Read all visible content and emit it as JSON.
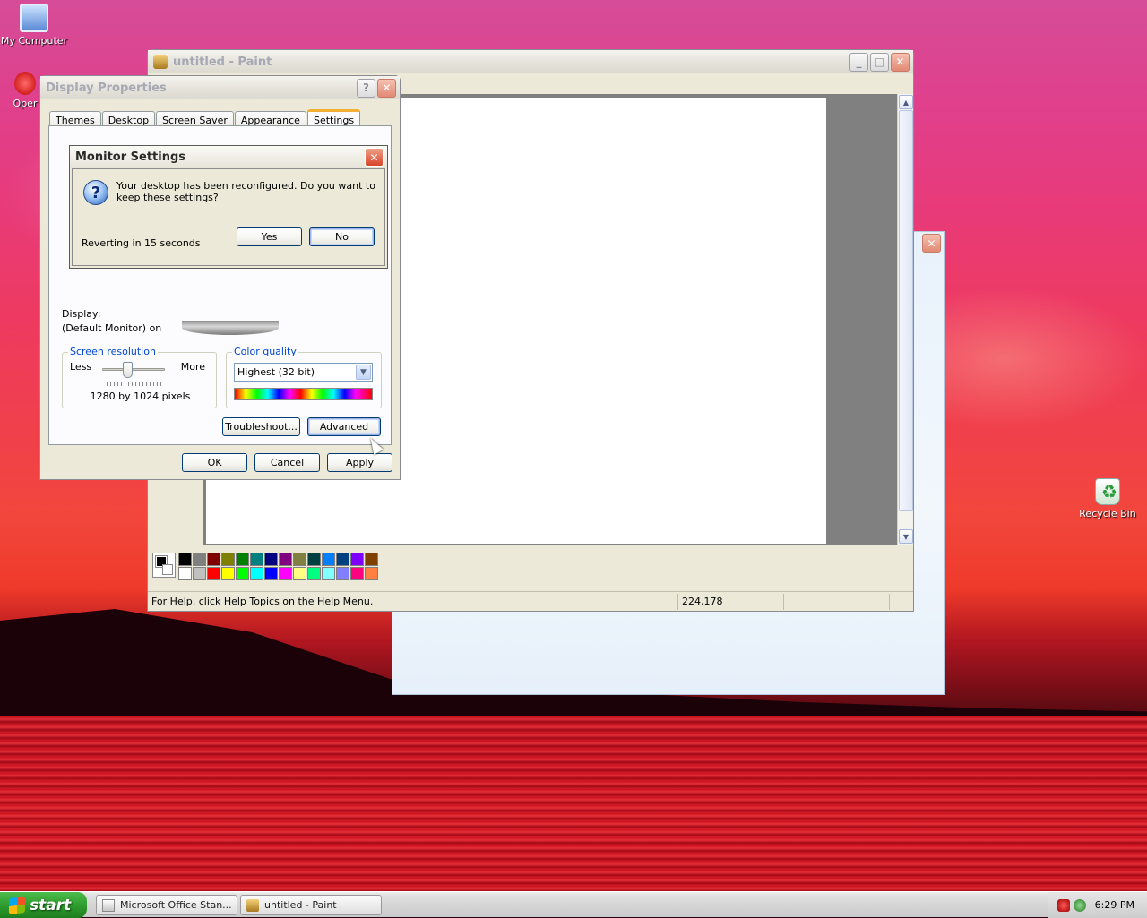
{
  "desktop": {
    "icons": [
      {
        "label": "My Computer"
      },
      {
        "label": "Oper"
      },
      {
        "label": "Recycle Bin"
      }
    ]
  },
  "paint": {
    "title": "untitled - Paint",
    "status_help": "For Help, click Help Topics on the Help Menu.",
    "status_coords": "224,178",
    "palette": [
      "#000000",
      "#808080",
      "#800000",
      "#808000",
      "#008000",
      "#008080",
      "#000080",
      "#800080",
      "#808040",
      "#004040",
      "#0080ff",
      "#004080",
      "#8000ff",
      "#804000",
      "#ffffff",
      "#c0c0c0",
      "#ff0000",
      "#ffff00",
      "#00ff00",
      "#00ffff",
      "#0000ff",
      "#ff00ff",
      "#ffff80",
      "#00ff80",
      "#80ffff",
      "#8080ff",
      "#ff0080",
      "#ff8040"
    ]
  },
  "display_properties": {
    "title": "Display Properties",
    "tabs": [
      {
        "label": "Themes"
      },
      {
        "label": "Desktop"
      },
      {
        "label": "Screen Saver"
      },
      {
        "label": "Appearance"
      },
      {
        "label": "Settings"
      }
    ],
    "active_tab": "Settings",
    "display_label": "Display:",
    "display_value": "(Default Monitor) on",
    "screen_resolution": {
      "label": "Screen resolution",
      "less": "Less",
      "more": "More",
      "value": "1280 by 1024 pixels"
    },
    "color_quality": {
      "label": "Color quality",
      "selected": "Highest (32 bit)"
    },
    "buttons": {
      "troubleshoot": "Troubleshoot...",
      "advanced": "Advanced",
      "ok": "OK",
      "cancel": "Cancel",
      "apply": "Apply"
    }
  },
  "monitor_settings": {
    "title": "Monitor Settings",
    "message": "Your desktop has been reconfigured.  Do you want to keep these settings?",
    "countdown": "Reverting in 15 seconds",
    "yes": "Yes",
    "no": "No"
  },
  "taskbar": {
    "start_label": "start",
    "tasks": [
      {
        "label": "Microsoft Office Stan..."
      },
      {
        "label": "untitled - Paint"
      }
    ],
    "clock": "6:29 PM"
  }
}
